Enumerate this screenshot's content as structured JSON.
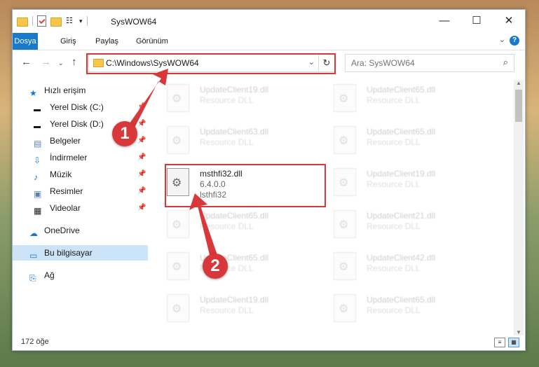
{
  "window": {
    "title": "SysWOW64"
  },
  "ribbon": {
    "tabs": [
      "Dosya",
      "Giriş",
      "Paylaş",
      "Görünüm"
    ]
  },
  "address": {
    "path": "C:\\Windows\\SysWOW64"
  },
  "search": {
    "placeholder": "Ara: SysWOW64"
  },
  "nav": {
    "items": [
      {
        "label": "Hızlı erişim",
        "icon": "star-icon",
        "pinned": false
      },
      {
        "label": "Yerel Disk (C:)",
        "icon": "drive-icon",
        "pinned": true
      },
      {
        "label": "Yerel Disk (D:)",
        "icon": "drive-icon",
        "pinned": true
      },
      {
        "label": "Belgeler",
        "icon": "documents-icon",
        "pinned": true
      },
      {
        "label": "İndirmeler",
        "icon": "download-icon",
        "pinned": true
      },
      {
        "label": "Müzik",
        "icon": "music-icon",
        "pinned": true
      },
      {
        "label": "Resimler",
        "icon": "pictures-icon",
        "pinned": true
      },
      {
        "label": "Videolar",
        "icon": "videos-icon",
        "pinned": true
      },
      {
        "label": "OneDrive",
        "icon": "cloud-icon",
        "pinned": false
      },
      {
        "label": "Bu bilgisayar",
        "icon": "computer-icon",
        "pinned": false,
        "selected": true
      },
      {
        "label": "Ağ",
        "icon": "network-icon",
        "pinned": false
      }
    ]
  },
  "files": {
    "left": [
      {
        "name": "UpdateClient19.dll",
        "type": "Resource DLL"
      },
      {
        "name": "UpdateClient63.dll",
        "type": "Resource DLL"
      },
      {
        "name": "msthfi32.dll",
        "version": "6.4.0.0",
        "desc": "lsthfi32",
        "highlighted": true
      },
      {
        "name": "UpdateClient65.dll",
        "type": "Resource DLL"
      },
      {
        "name": "UpdateClient65.dll",
        "type": "Resource DLL"
      },
      {
        "name": "UpdateClient19.dll",
        "type": "Resource DLL"
      }
    ],
    "right": [
      {
        "name": "UpdateClient65.dll",
        "type": "Resource DLL"
      },
      {
        "name": "UpdateClient65.dll",
        "type": "Resource DLL"
      },
      {
        "name": "UpdateClient19.dll",
        "type": "Resource DLL"
      },
      {
        "name": "UpdateClient21.dll",
        "type": "Resource DLL"
      },
      {
        "name": "UpdateClient42.dll",
        "type": "Resource DLL"
      },
      {
        "name": "UpdateClient65.dll",
        "type": "Resource DLL"
      }
    ]
  },
  "status": {
    "count": "172 öğe"
  },
  "annotations": {
    "step1": "1",
    "step2": "2",
    "color": "#d8383a"
  }
}
